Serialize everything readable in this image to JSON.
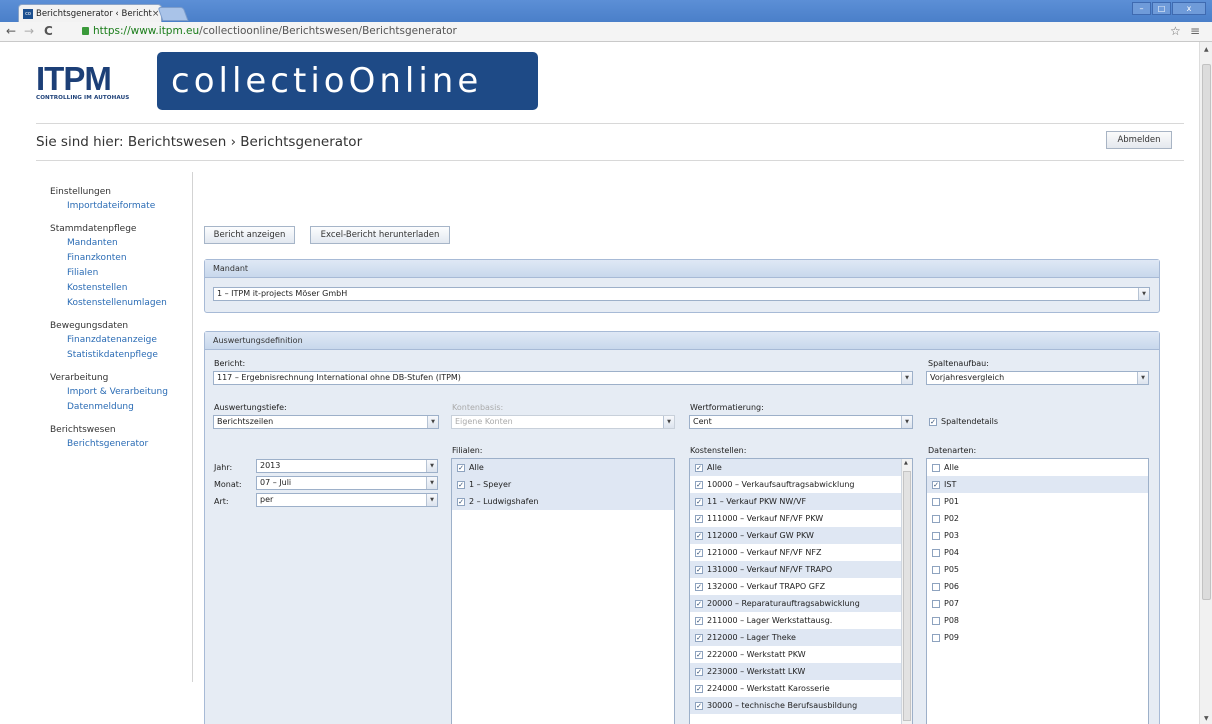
{
  "browser": {
    "tab_title": "Berichtsgenerator ‹ Bericht",
    "favicon_text": "co",
    "tab_close": "×",
    "url_host": "https://www.itpm.eu",
    "url_path": "/collectioonline/Berichtswesen/Berichtsgenerator"
  },
  "header": {
    "logo_big": "ITPM",
    "logo_sub": "CONTROLLING IM AUTOHAUS",
    "app_title": "collectioOnline",
    "breadcrumb": "Sie sind hier: Berichtswesen › Berichtsgenerator",
    "logout_label": "Abmelden"
  },
  "sidebar": {
    "groups": [
      {
        "title": "Einstellungen",
        "items": [
          "Importdateiformate"
        ]
      },
      {
        "title": "Stammdatenpflege",
        "items": [
          "Mandanten",
          "Finanzkonten",
          "Filialen",
          "Kostenstellen",
          "Kostenstellenumlagen"
        ]
      },
      {
        "title": "Bewegungsdaten",
        "items": [
          "Finanzdatenanzeige",
          "Statistikdatenpflege"
        ]
      },
      {
        "title": "Verarbeitung",
        "items": [
          "Import & Verarbeitung",
          "Datenmeldung"
        ]
      },
      {
        "title": "Berichtswesen",
        "items": [
          "Berichtsgenerator"
        ]
      }
    ]
  },
  "actions": {
    "show_report": "Bericht anzeigen",
    "download_excel": "Excel-Bericht herunterladen"
  },
  "mandant": {
    "panel_title": "Mandant",
    "value": "1 – ITPM it-projects Möser GmbH"
  },
  "auswertung": {
    "panel_title": "Auswertungsdefinition",
    "bericht_label": "Bericht:",
    "bericht_value": "117 – Ergebnisrechnung International ohne DB-Stufen (ITPM)",
    "spaltenaufbau_label": "Spaltenaufbau:",
    "spaltenaufbau_value": "Vorjahresvergleich",
    "tiefe_label": "Auswertungstiefe:",
    "tiefe_value": "Berichtszeilen",
    "kontenbasis_label": "Kontenbasis:",
    "kontenbasis_value": "Eigene Konten",
    "wertformat_label": "Wertformatierung:",
    "wertformat_value": "Cent",
    "spaltendetails_label": "Spaltendetails",
    "spaltendetails_checked": true,
    "jahr_label": "Jahr:",
    "jahr_value": "2013",
    "monat_label": "Monat:",
    "monat_value": "07 – Juli",
    "art_label": "Art:",
    "art_value": "per",
    "filialen_label": "Filialen:",
    "filialen": [
      "Alle",
      "1 – Speyer",
      "2 – Ludwigshafen"
    ],
    "kostenstellen_label": "Kostenstellen:",
    "kostenstellen": [
      "Alle",
      "10000 – Verkaufsauftragsabwicklung",
      "11 – Verkauf PKW NW/VF",
      "111000 – Verkauf NF/VF PKW",
      "112000 – Verkauf GW PKW",
      "121000 – Verkauf NF/VF NFZ",
      "131000 – Verkauf NF/VF TRAPO",
      "132000 – Verkauf TRAPO GFZ",
      "20000 – Reparaturauftragsabwicklung",
      "211000 – Lager Werkstattausg.",
      "212000 – Lager Theke",
      "222000 – Werkstatt PKW",
      "223000 – Werkstatt LKW",
      "224000 – Werkstatt Karosserie",
      "30000 – technische Berufsausbildung"
    ],
    "datenarten_label": "Datenarten:",
    "datenarten": [
      "Alle",
      "IST",
      "P01",
      "P02",
      "P03",
      "P04",
      "P05",
      "P06",
      "P07",
      "P08",
      "P09"
    ],
    "datenarten_checked": [
      false,
      true,
      false,
      false,
      false,
      false,
      false,
      false,
      false,
      false,
      false
    ]
  }
}
